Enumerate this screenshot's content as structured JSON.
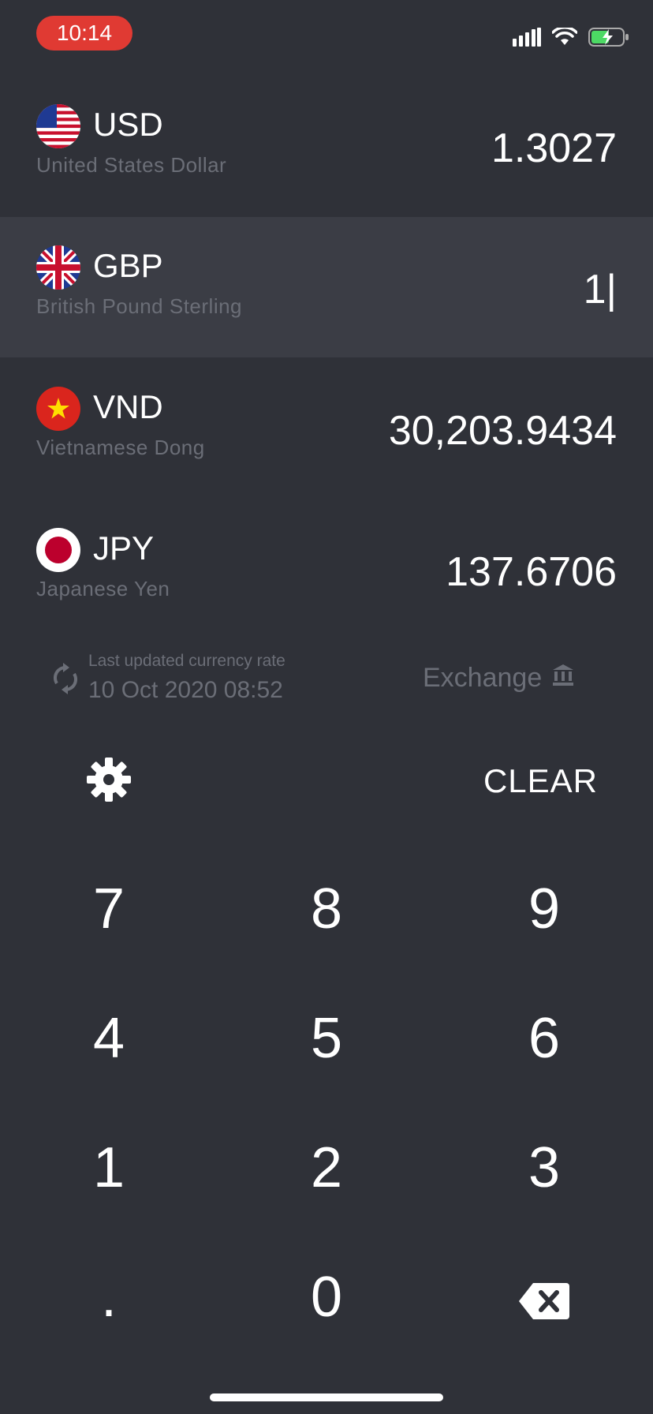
{
  "status_bar": {
    "time": "10:14",
    "signal_icon": "cellular-signal-icon",
    "wifi_icon": "wifi-icon",
    "battery_icon": "battery-charging-icon",
    "time_pill_color": "#e03a33",
    "battery_accent": "#4cd964"
  },
  "currencies": [
    {
      "code": "USD",
      "name": "United States Dollar",
      "value": "1.3027",
      "flag_icon": "us-flag-icon"
    },
    {
      "code": "GBP",
      "name": "British Pound Sterling",
      "value": "1|",
      "flag_icon": "uk-flag-icon",
      "selected": true
    },
    {
      "code": "VND",
      "name": "Vietnamese Dong",
      "value": "30,203.9434",
      "flag_icon": "vietnam-flag-icon"
    },
    {
      "code": "JPY",
      "name": "Japanese Yen",
      "value": "137.6706",
      "flag_icon": "japan-flag-icon"
    }
  ],
  "info": {
    "updated_label": "Last updated currency rate",
    "updated_date": "10 Oct 2020 08:52",
    "exchange_label": "Exchange",
    "refresh_icon": "refresh-icon",
    "bank_icon": "bank-icon"
  },
  "toolbar": {
    "settings_icon": "gear-icon",
    "clear_label": "CLEAR"
  },
  "keypad": {
    "keys": [
      "7",
      "8",
      "9",
      "4",
      "5",
      "6",
      "1",
      "2",
      "3",
      ".",
      "0"
    ],
    "backspace_icon": "backspace-icon"
  },
  "colors": {
    "background": "#2f3138",
    "selected_row": "#3b3d45",
    "muted_text": "#6b6e77",
    "text": "#ffffff"
  }
}
